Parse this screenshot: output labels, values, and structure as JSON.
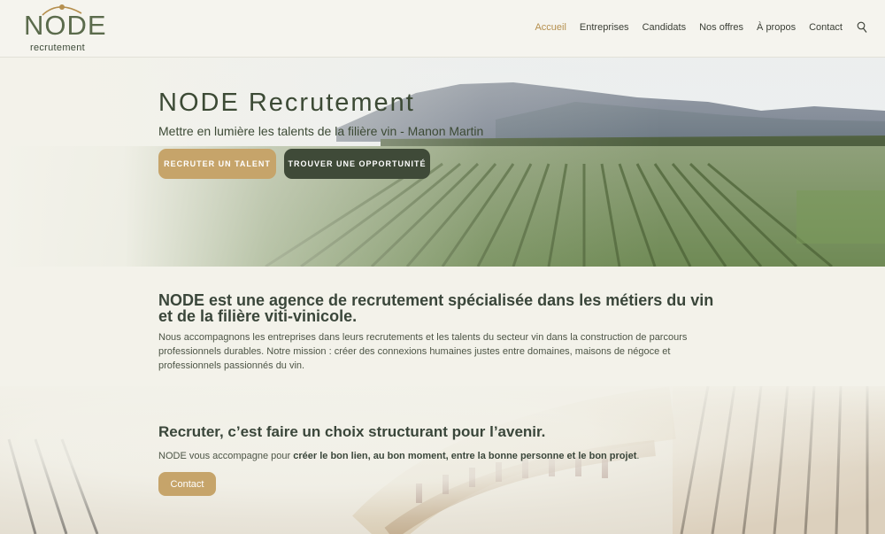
{
  "brand": {
    "name": "NODE",
    "tagline": "recrutement",
    "gold": "#b58f4e",
    "dark_green": "#3f4a38"
  },
  "nav": {
    "items": [
      {
        "label": "Accueil",
        "active": true
      },
      {
        "label": "Entreprises",
        "active": false
      },
      {
        "label": "Candidats",
        "active": false
      },
      {
        "label": "Nos offres",
        "active": false
      },
      {
        "label": "À propos",
        "active": false
      },
      {
        "label": "Contact",
        "active": false
      }
    ],
    "search_icon": "search-icon"
  },
  "hero": {
    "title": "NODE Recrutement",
    "subtitle": "Mettre en lumière les talents de la filière vin - Manon Martin",
    "primary_button": "RECRUTER UN TALENT",
    "secondary_button": "TROUVER UNE OPPORTUNITÉ"
  },
  "intro": {
    "title": "NODE est une agence de recrutement spécialisée dans les métiers du vin et de la filière viti-vinicole.",
    "text": "Nous accompagnons les entreprises dans leurs recrutements et les talents du secteur vin dans la construction de parcours professionnels durables. Notre mission : créer des connexions humaines justes entre domaines, maisons de négoce et professionnels passionnés du vin."
  },
  "section": {
    "title": "Recruter, c’est faire un choix structurant pour l’avenir.",
    "text_prefix": "NODE vous accompagne pour ",
    "text_bold": "créer le bon lien, au bon moment, entre la bonne personne et le bon projet",
    "text_suffix": ".",
    "button": "Contact"
  }
}
